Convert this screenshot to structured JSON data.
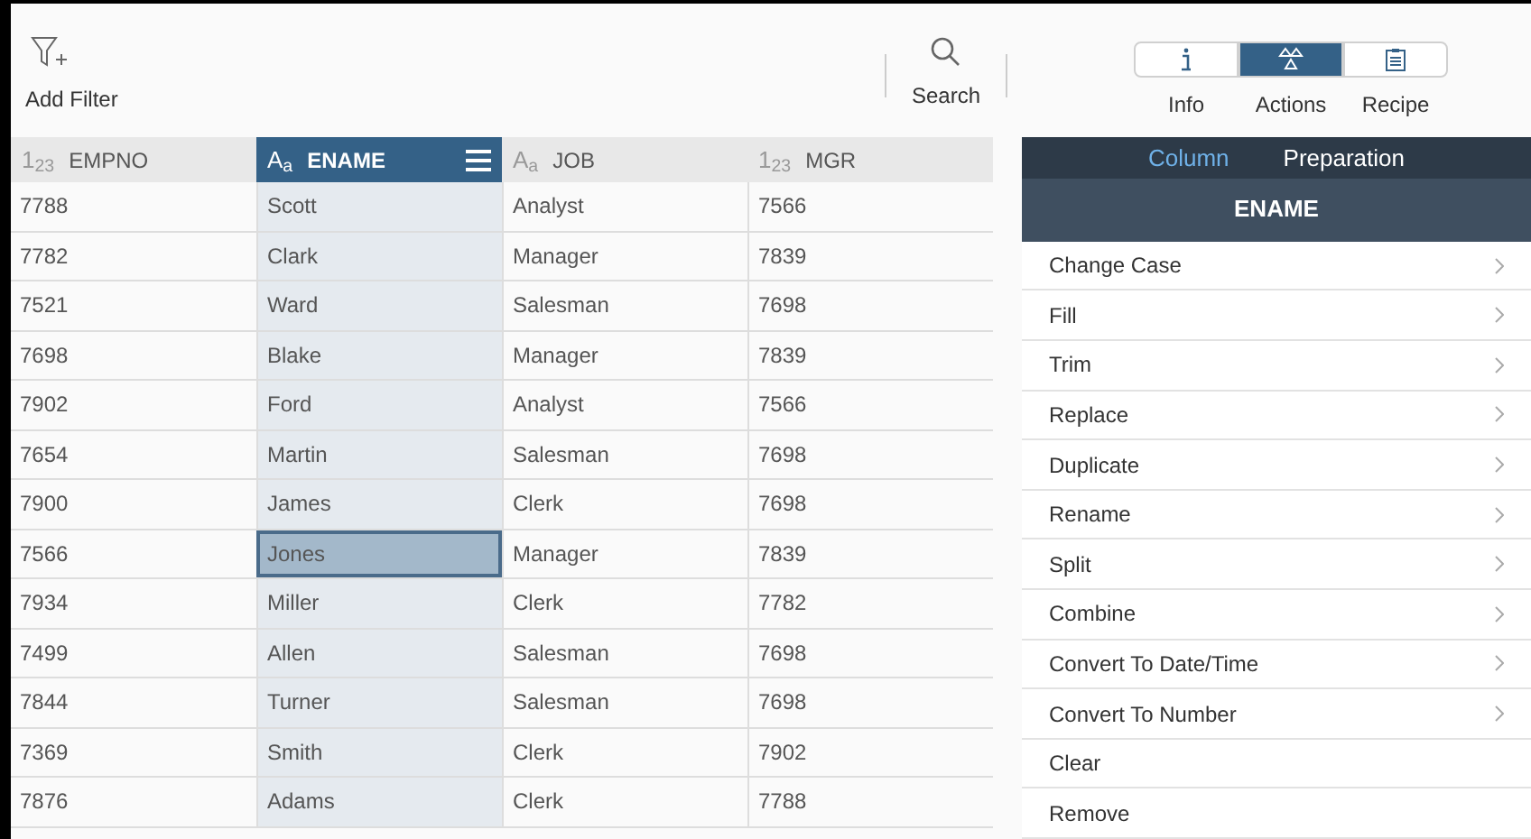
{
  "toolbar": {
    "add_filter": "Add Filter",
    "search": "Search",
    "views": [
      {
        "label": "Info",
        "kind": "info",
        "selected": false
      },
      {
        "label": "Actions",
        "kind": "actions",
        "selected": true
      },
      {
        "label": "Recipe",
        "kind": "recipe",
        "selected": false
      }
    ]
  },
  "table": {
    "columns": [
      {
        "type_icon": "1$_{23}$",
        "name": "EMPNO",
        "selected": false
      },
      {
        "type_icon": "A$_{a}$",
        "name": "ENAME",
        "selected": true
      },
      {
        "type_icon": "A$_{a}$",
        "name": "JOB",
        "selected": false
      },
      {
        "type_icon": "1$_{23}$",
        "name": "MGR",
        "selected": false
      }
    ],
    "rows": [
      {
        "cells": [
          "7788",
          "Scott",
          "Analyst",
          "7566"
        ],
        "selected": false
      },
      {
        "cells": [
          "7782",
          "Clark",
          "Manager",
          "7839"
        ],
        "selected": false
      },
      {
        "cells": [
          "7521",
          "Ward",
          "Salesman",
          "7698"
        ],
        "selected": false
      },
      {
        "cells": [
          "7698",
          "Blake",
          "Manager",
          "7839"
        ],
        "selected": false
      },
      {
        "cells": [
          "7902",
          "Ford",
          "Analyst",
          "7566"
        ],
        "selected": false
      },
      {
        "cells": [
          "7654",
          "Martin",
          "Salesman",
          "7698"
        ],
        "selected": false
      },
      {
        "cells": [
          "7900",
          "James",
          "Clerk",
          "7698"
        ],
        "selected": false
      },
      {
        "cells": [
          "7566",
          "Jones",
          "Manager",
          "7839"
        ],
        "selected": true
      },
      {
        "cells": [
          "7934",
          "Miller",
          "Clerk",
          "7782"
        ],
        "selected": false
      },
      {
        "cells": [
          "7499",
          "Allen",
          "Salesman",
          "7698"
        ],
        "selected": false
      },
      {
        "cells": [
          "7844",
          "Turner",
          "Salesman",
          "7698"
        ],
        "selected": false
      },
      {
        "cells": [
          "7369",
          "Smith",
          "Clerk",
          "7902"
        ],
        "selected": false
      },
      {
        "cells": [
          "7876",
          "Adams",
          "Clerk",
          "7788"
        ],
        "selected": false
      }
    ]
  },
  "panel": {
    "tabs": [
      {
        "label": "Column",
        "selected": true
      },
      {
        "label": "Preparation",
        "selected": false
      }
    ],
    "column_name": "ENAME",
    "actions": [
      {
        "label": "Change Case",
        "has_submenu": true
      },
      {
        "label": "Fill",
        "has_submenu": true
      },
      {
        "label": "Trim",
        "has_submenu": true
      },
      {
        "label": "Replace",
        "has_submenu": true
      },
      {
        "label": "Duplicate",
        "has_submenu": true
      },
      {
        "label": "Rename",
        "has_submenu": true
      },
      {
        "label": "Split",
        "has_submenu": true
      },
      {
        "label": "Combine",
        "has_submenu": true
      },
      {
        "label": "Convert To Date/Time",
        "has_submenu": true
      },
      {
        "label": "Convert To Number",
        "has_submenu": true
      },
      {
        "label": "Clear",
        "has_submenu": false
      },
      {
        "label": "Remove",
        "has_submenu": false
      }
    ]
  }
}
